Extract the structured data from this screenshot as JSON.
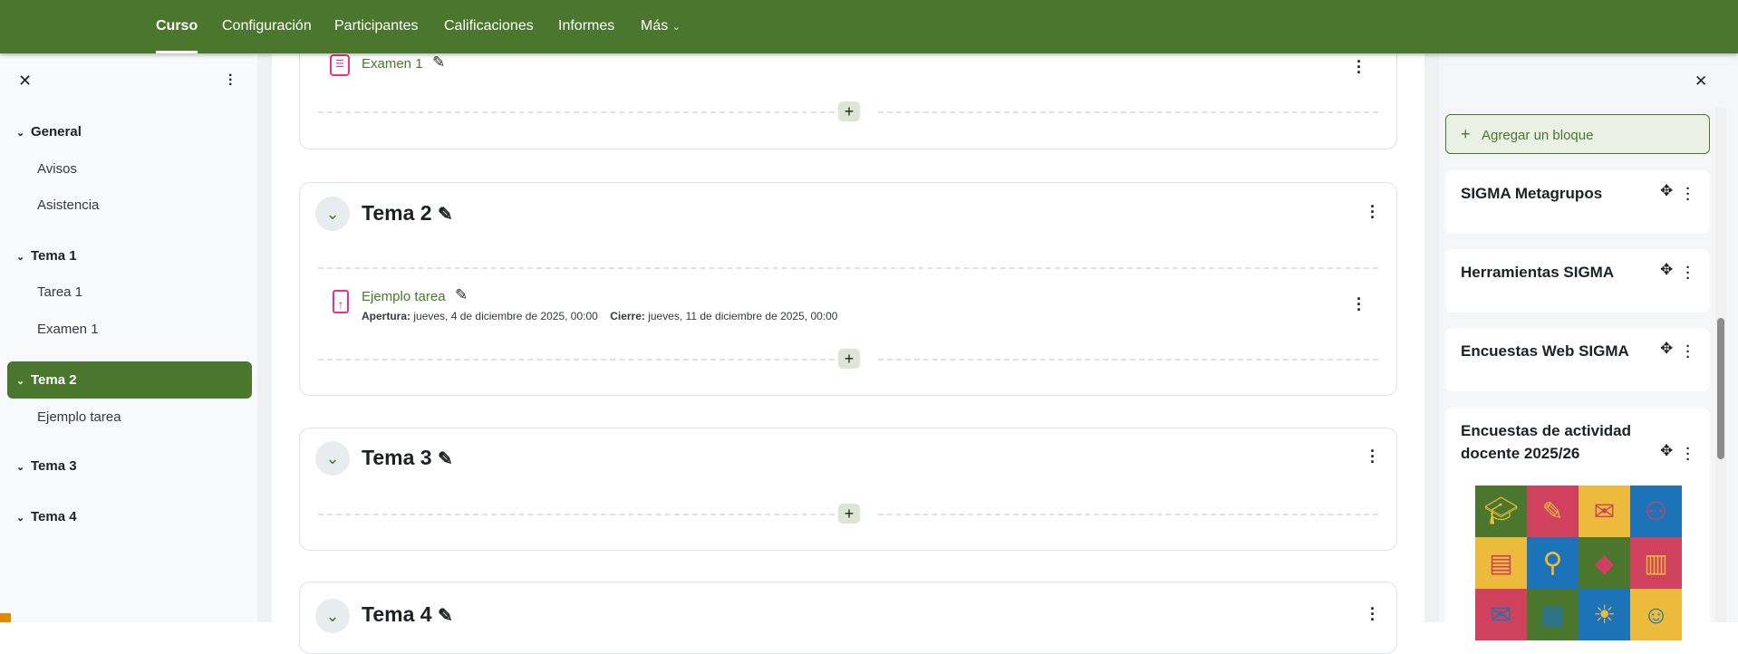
{
  "topnav": {
    "items": [
      "Curso",
      "Configuración",
      "Participantes",
      "Calificaciones",
      "Informes",
      "Más"
    ],
    "active": "Curso"
  },
  "left_drawer": {
    "sections": [
      {
        "label": "General",
        "items": [
          "Avisos",
          "Asistencia"
        ]
      },
      {
        "label": "Tema 1",
        "items": [
          "Tarea 1",
          "Examen 1"
        ]
      },
      {
        "label": "Tema 2",
        "items": [
          "Ejemplo tarea"
        ]
      },
      {
        "label": "Tema 3",
        "items": []
      },
      {
        "label": "Tema 4",
        "items": []
      }
    ]
  },
  "main": {
    "prev_activity": "Examen 1",
    "sections": [
      {
        "title": "Tema 2",
        "activity": {
          "name": "Ejemplo tarea",
          "open_label": "Apertura:",
          "open_value": "jueves, 4 de diciembre de 2025, 00:00",
          "close_label": "Cierre:",
          "close_value": "jueves, 11 de diciembre de 2025, 00:00"
        }
      },
      {
        "title": "Tema 3"
      },
      {
        "title": "Tema 4"
      }
    ]
  },
  "right_drawer": {
    "add_block": "Agregar un bloque",
    "blocks": [
      "SIGMA Metagrupos",
      "Herramientas SIGMA",
      "Encuestas Web SIGMA",
      "Encuestas de actividad docente 2025/26"
    ]
  },
  "colors": {
    "brand": "#4b762d",
    "activity_icon": "#e8318a"
  }
}
